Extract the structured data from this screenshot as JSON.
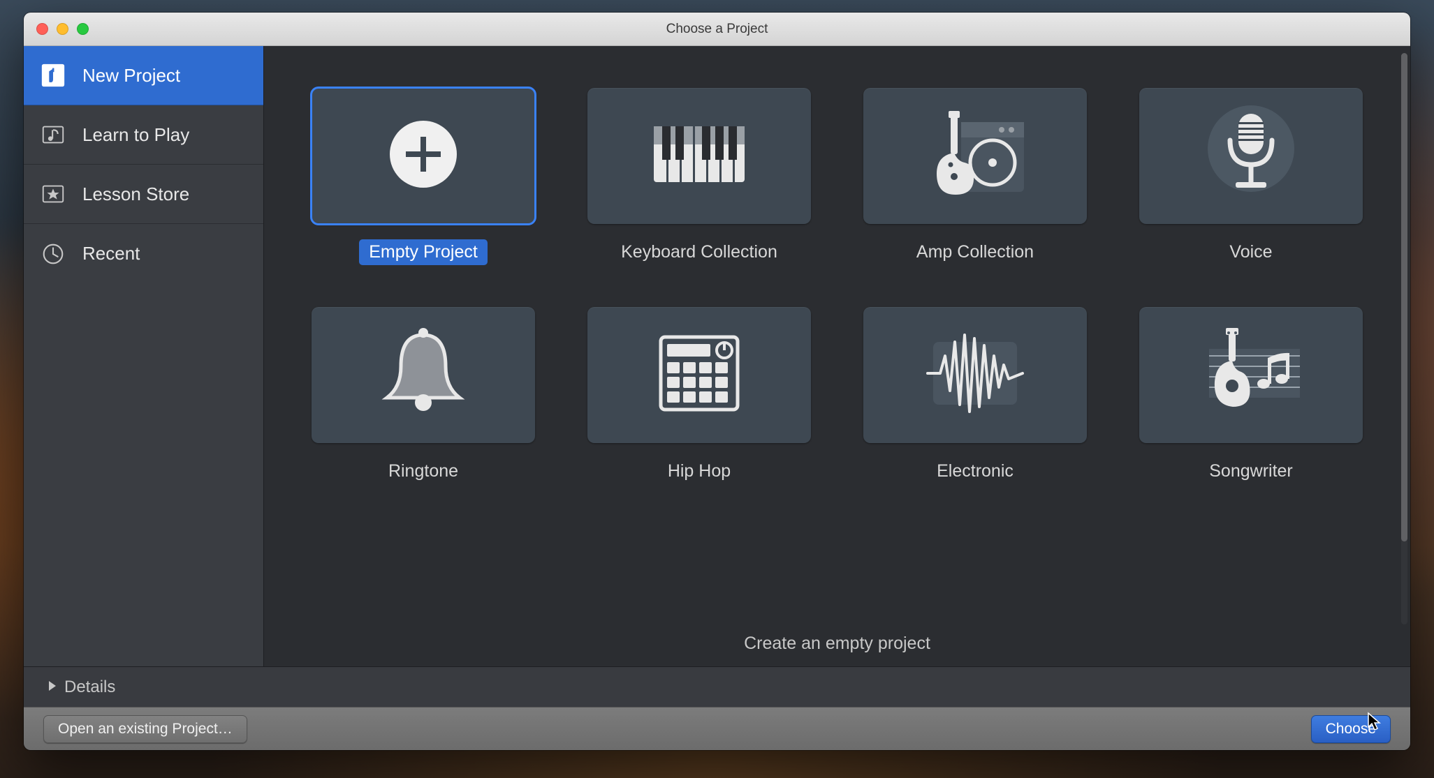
{
  "window": {
    "title": "Choose a Project"
  },
  "sidebar": {
    "items": [
      {
        "label": "New Project",
        "active": true
      },
      {
        "label": "Learn to Play",
        "active": false
      },
      {
        "label": "Lesson Store",
        "active": false
      },
      {
        "label": "Recent",
        "active": false
      }
    ]
  },
  "templates": [
    {
      "label": "Empty Project",
      "icon": "plus",
      "selected": true
    },
    {
      "label": "Keyboard Collection",
      "icon": "keyboard",
      "selected": false
    },
    {
      "label": "Amp Collection",
      "icon": "amp",
      "selected": false
    },
    {
      "label": "Voice",
      "icon": "mic",
      "selected": false
    },
    {
      "label": "Ringtone",
      "icon": "bell",
      "selected": false
    },
    {
      "label": "Hip Hop",
      "icon": "drummachine",
      "selected": false
    },
    {
      "label": "Electronic",
      "icon": "waveform",
      "selected": false
    },
    {
      "label": "Songwriter",
      "icon": "guitar",
      "selected": false
    }
  ],
  "description": "Create an empty project",
  "details": {
    "label": "Details"
  },
  "footer": {
    "open_label": "Open an existing Project…",
    "choose_label": "Choose"
  }
}
